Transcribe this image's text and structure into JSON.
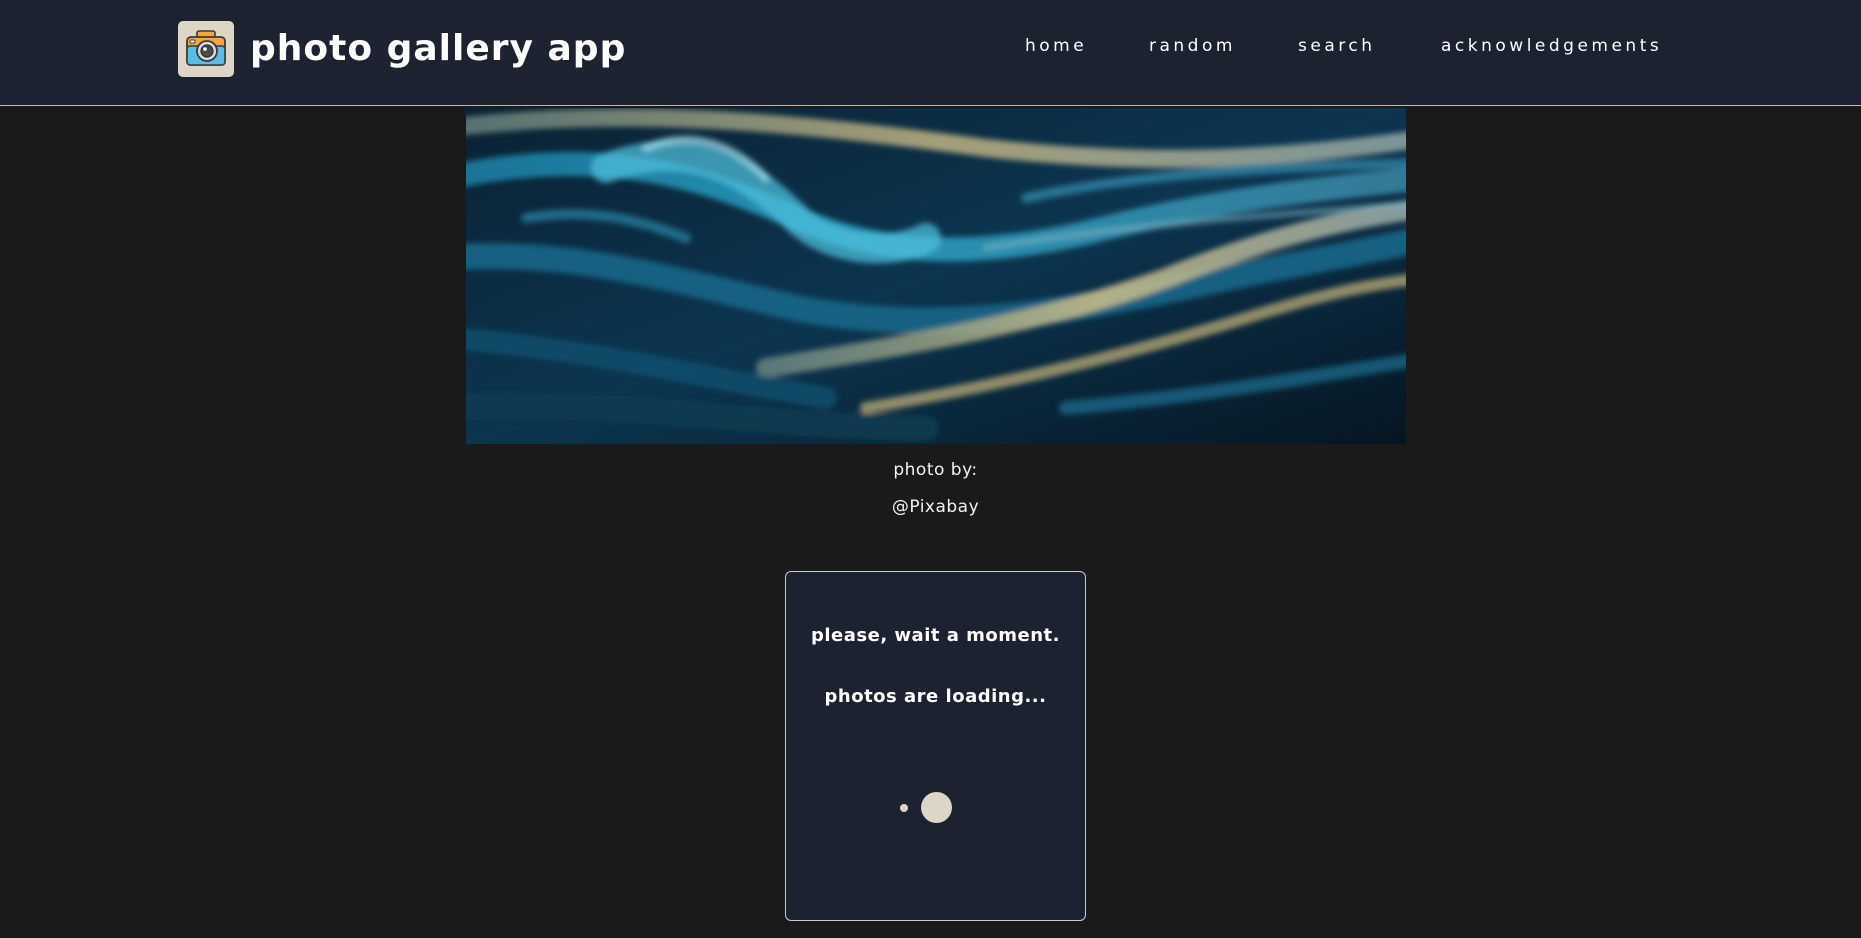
{
  "header": {
    "app_title": "photo gallery app",
    "logo_icon": "camera-icon",
    "nav": {
      "home": "home",
      "random": "random",
      "search": "search",
      "acknowledgements": "acknowledgements"
    }
  },
  "hero": {
    "credit_label": "photo by:",
    "credit_name": "@Pixabay"
  },
  "loading": {
    "line1": "please, wait a moment.",
    "line2": "photos are loading..."
  },
  "colors": {
    "header_bg": "#1c2230",
    "page_bg": "#1a1a1a",
    "accent_beige": "#ddd6c6"
  }
}
